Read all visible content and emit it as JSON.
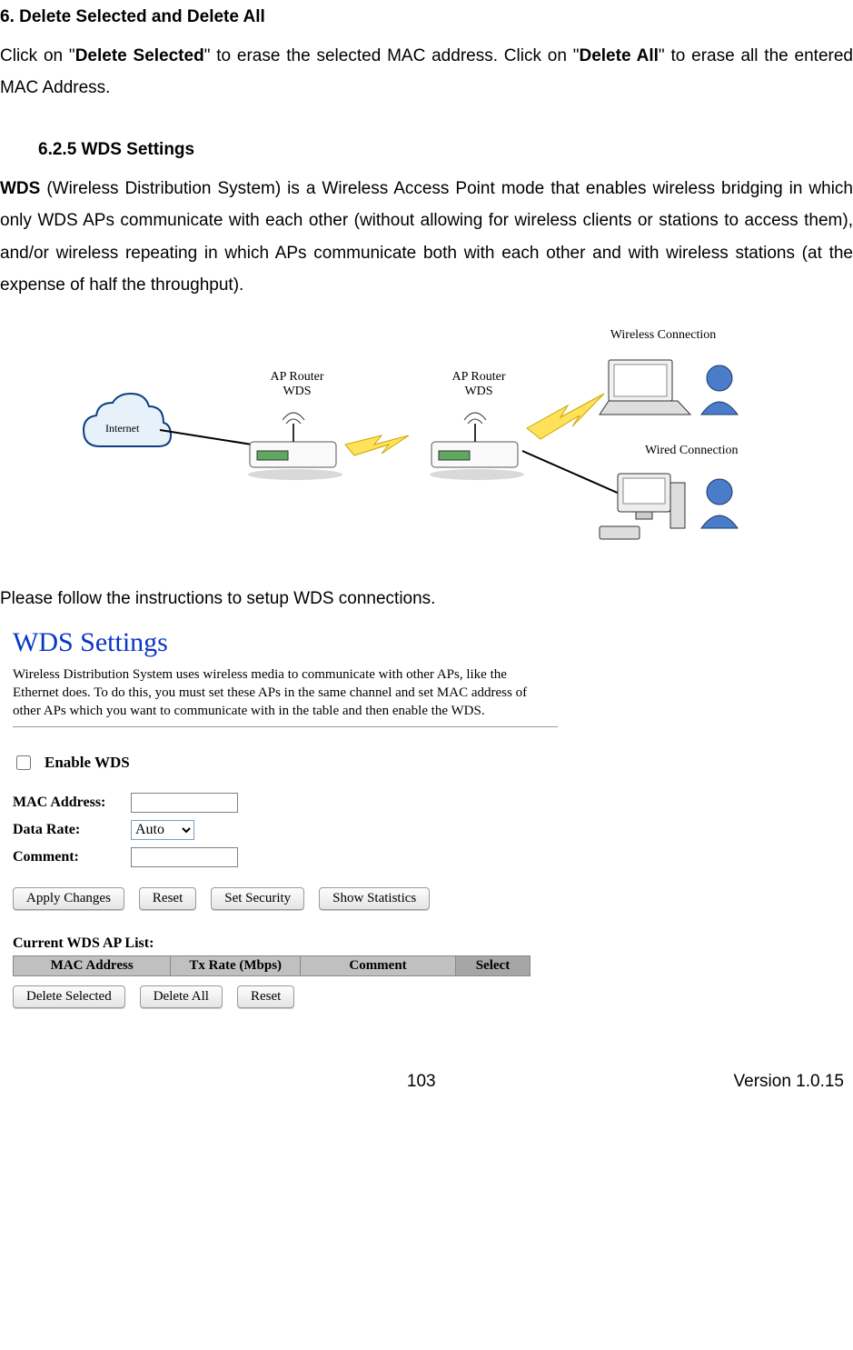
{
  "section6": {
    "heading": "6.    Delete Selected and Delete All",
    "para_parts": [
      "Click on \"",
      "Delete Selected",
      "\" to erase the selected MAC address. Click on \"",
      "Delete All",
      "\" to erase all the entered MAC Address."
    ]
  },
  "section625": {
    "heading": "6.2.5    WDS Settings",
    "para_parts": [
      "WDS",
      " (Wireless Distribution System) is a Wireless Access Point mode that enables wireless bridging in which only WDS APs communicate with each other (without allowing for wireless clients or stations to access them), and/or wireless repeating in which APs communicate both with each other and with wireless stations (at the expense of half the throughput)."
    ],
    "followup": "Please follow the instructions to setup WDS connections."
  },
  "diagram": {
    "internet": "Internet",
    "ap1_l1": "AP Router",
    "ap1_l2": "WDS",
    "ap2_l1": "AP Router",
    "ap2_l2": "WDS",
    "wireless": "Wireless Connection",
    "wired": "Wired Connection"
  },
  "wds": {
    "title": "WDS Settings",
    "desc": "Wireless Distribution System uses wireless media to communicate with other APs, like the Ethernet does. To do this, you must set these APs in the same channel and set MAC address of other APs which you want to communicate with in the table and then enable the WDS.",
    "enable": "Enable WDS",
    "mac_label": "MAC Address:",
    "rate_label": "Data Rate:",
    "rate_value": "Auto",
    "comment_label": "Comment:",
    "btn_apply": "Apply Changes",
    "btn_reset": "Reset",
    "btn_sec": "Set Security",
    "btn_stats": "Show Statistics",
    "list_heading": "Current WDS AP List:",
    "cols": {
      "mac": "MAC Address",
      "tx": "Tx Rate (Mbps)",
      "comment": "Comment",
      "select": "Select"
    },
    "btn_delsel": "Delete Selected",
    "btn_delall": "Delete All",
    "btn_reset2": "Reset"
  },
  "footer": {
    "page": "103",
    "version": "Version 1.0.15"
  }
}
